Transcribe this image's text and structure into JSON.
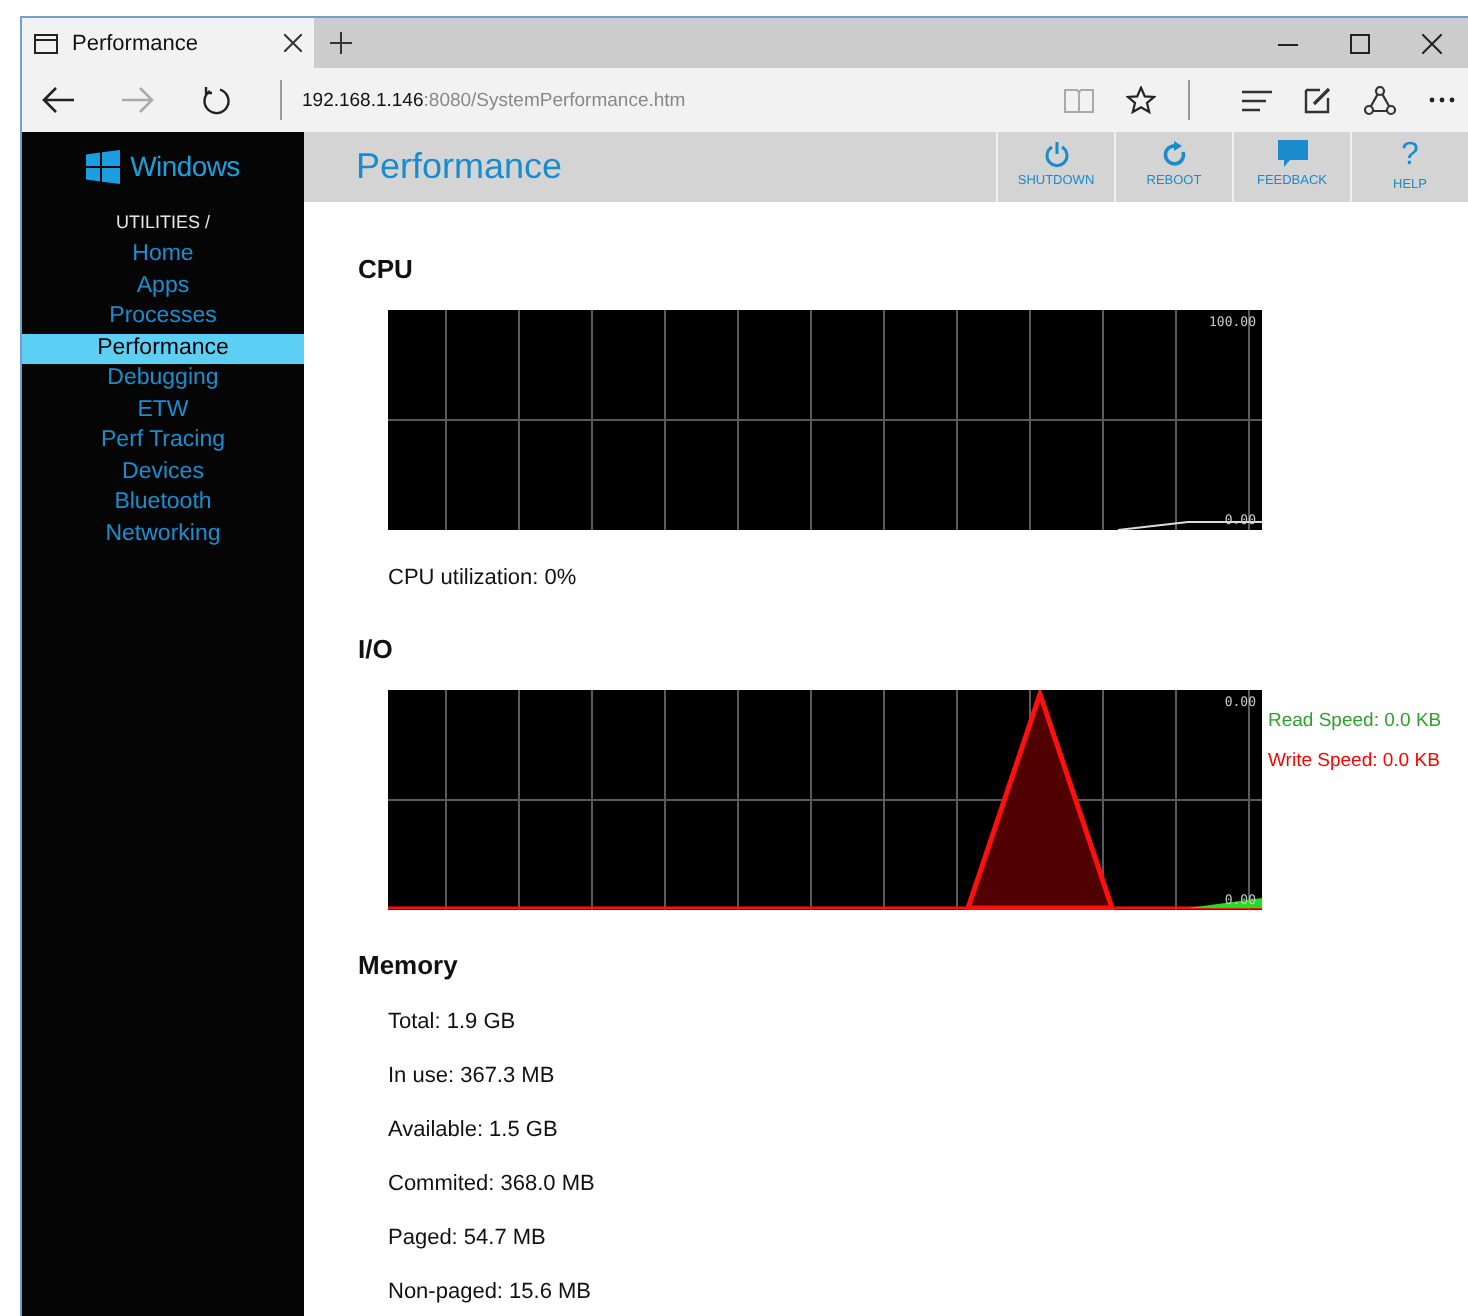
{
  "browser": {
    "tab_title": "Performance",
    "address": {
      "host": "192.168.1.146",
      "rest": ":8080/SystemPerformance.htm"
    }
  },
  "sidebar": {
    "brand": "Windows",
    "section": "UTILITIES /",
    "items": [
      {
        "label": "Home",
        "selected": false
      },
      {
        "label": "Apps",
        "selected": false
      },
      {
        "label": "Processes",
        "selected": false
      },
      {
        "label": "Performance",
        "selected": true
      },
      {
        "label": "Debugging",
        "selected": false
      },
      {
        "label": "ETW",
        "selected": false
      },
      {
        "label": "Perf Tracing",
        "selected": false
      },
      {
        "label": "Devices",
        "selected": false
      },
      {
        "label": "Bluetooth",
        "selected": false
      },
      {
        "label": "Networking",
        "selected": false
      }
    ]
  },
  "header": {
    "title": "Performance",
    "actions": [
      {
        "label": "SHUTDOWN",
        "kind": "power"
      },
      {
        "label": "REBOOT",
        "kind": "restart"
      },
      {
        "label": "FEEDBACK",
        "kind": "feedback"
      },
      {
        "label": "HELP",
        "kind": "help",
        "glyph": "?"
      }
    ]
  },
  "cpu": {
    "heading": "CPU",
    "chart": {
      "top_label": "100.00",
      "bottom_label": "0.00"
    },
    "utilization": "CPU utilization: 0%"
  },
  "io": {
    "heading": "I/O",
    "chart": {
      "top_label": "0.00",
      "bottom_label": "0.00"
    },
    "legend": [
      {
        "text": "Read Speed: 0.0 KB",
        "color": "#2e9e2e"
      },
      {
        "text": "Write Speed: 0.0 KB",
        "color": "#ff0000"
      }
    ]
  },
  "memory": {
    "heading": "Memory",
    "rows": [
      "Total: 1.9 GB",
      "In use: 367.3 MB",
      "Available: 1.5 GB",
      "Commited: 368.0 MB",
      "Paged: 54.7 MB",
      "Non-paged: 15.6 MB"
    ]
  }
}
